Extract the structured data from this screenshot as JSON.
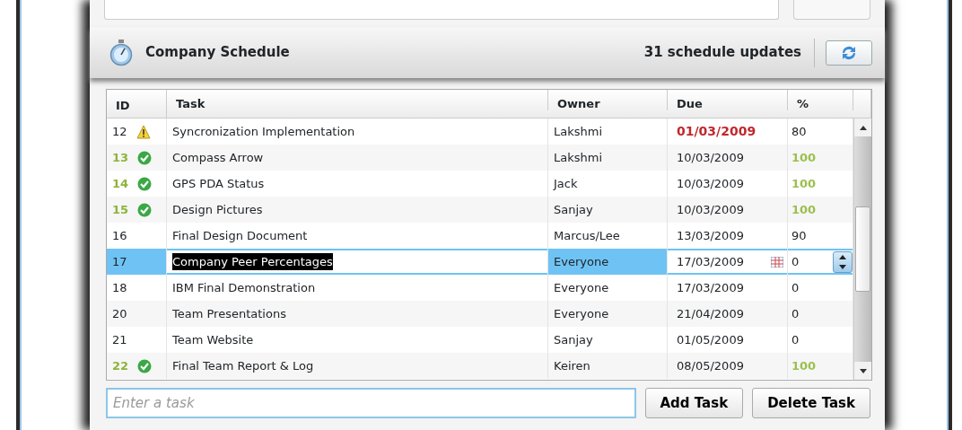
{
  "header": {
    "title": "Company Schedule",
    "updates": "31 schedule updates"
  },
  "table": {
    "columns": [
      "ID",
      "Task",
      "Owner",
      "Due",
      "%"
    ],
    "rows": [
      {
        "id": "12",
        "warning": true,
        "complete": false,
        "task": "Syncronization Implementation",
        "owner": "Lakshmi",
        "due": "01/03/2009",
        "overdue": true,
        "percent": "80",
        "selected": false
      },
      {
        "id": "13",
        "warning": false,
        "complete": true,
        "task": "Compass Arrow",
        "owner": "Lakshmi",
        "due": "10/03/2009",
        "overdue": false,
        "percent": "100",
        "selected": false
      },
      {
        "id": "14",
        "warning": false,
        "complete": true,
        "task": "GPS PDA Status",
        "owner": "Jack",
        "due": "10/03/2009",
        "overdue": false,
        "percent": "100",
        "selected": false
      },
      {
        "id": "15",
        "warning": false,
        "complete": true,
        "task": "Design Pictures",
        "owner": "Sanjay",
        "due": "10/03/2009",
        "overdue": false,
        "percent": "100",
        "selected": false
      },
      {
        "id": "16",
        "warning": false,
        "complete": false,
        "task": "Final Design Document",
        "owner": "Marcus/Lee",
        "due": "13/03/2009",
        "overdue": false,
        "percent": "90",
        "selected": false
      },
      {
        "id": "17",
        "warning": false,
        "complete": false,
        "task": "Company Peer Percentages",
        "owner": "Everyone",
        "due": "17/03/2009",
        "overdue": false,
        "percent": "0",
        "selected": true
      },
      {
        "id": "18",
        "warning": false,
        "complete": false,
        "task": "IBM Final Demonstration",
        "owner": "Everyone",
        "due": "17/03/2009",
        "overdue": false,
        "percent": "0",
        "selected": false
      },
      {
        "id": "20",
        "warning": false,
        "complete": false,
        "task": "Team Presentations",
        "owner": "Everyone",
        "due": "21/04/2009",
        "overdue": false,
        "percent": "0",
        "selected": false
      },
      {
        "id": "21",
        "warning": false,
        "complete": false,
        "task": "Team Website",
        "owner": "Sanjay",
        "due": "01/05/2009",
        "overdue": false,
        "percent": "0",
        "selected": false
      },
      {
        "id": "22",
        "warning": false,
        "complete": true,
        "task": "Final Team Report & Log",
        "owner": "Keiren",
        "due": "08/05/2009",
        "overdue": false,
        "percent": "100",
        "selected": false
      }
    ]
  },
  "task_field": {
    "placeholder": "Enter a task"
  },
  "buttons": [
    "Add Task",
    "Delete Task"
  ]
}
